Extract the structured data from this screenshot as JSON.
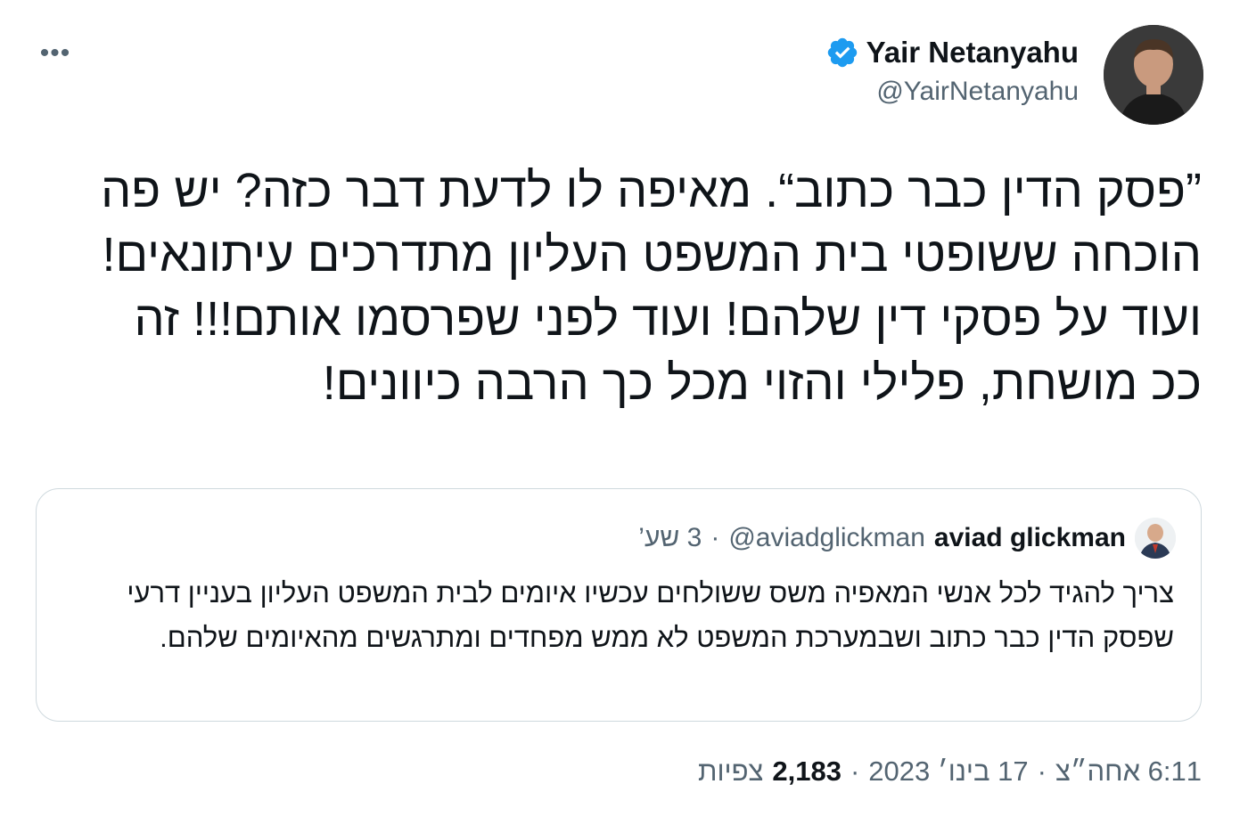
{
  "author": {
    "name": "Yair Netanyahu",
    "handle": "@YairNetanyahu"
  },
  "tweet": {
    "text": "”פסק הדין כבר כתוב“. מאיפה לו לדעת דבר כזה? יש פה הוכחה ששופטי בית המשפט העליון מתדרכים עיתונאים! ועוד על פסקי דין שלהם! ועוד לפני שפרסמו אותם!!! זה ככ מושחת, פלילי והזוי מכל כך הרבה כיוונים!"
  },
  "quote": {
    "name": "aviad glickman",
    "handle": "@aviadglickman",
    "separator": "·",
    "time": "3 שע’",
    "text": "צריך להגיד לכל אנשי המאפיה משס ששולחים עכשיו איומים לבית המשפט העליון בעניין דרעי שפסק הדין כבר כתוב ושבמערכת המשפט לא ממש מפחדים ומתרגשים מהאיומים שלהם."
  },
  "meta": {
    "time": "6:11 אחה״צ",
    "sep1": "·",
    "date": "17 בינו׳ 2023",
    "sep2": "·",
    "views": "2,183",
    "views_label": "צפיות"
  },
  "colors": {
    "verified": "#1d9bf0",
    "secondary_text": "#536471",
    "border": "#cfd9de"
  },
  "icons": {
    "more": "more-horizontal-icon",
    "verified": "verified-badge-icon"
  }
}
